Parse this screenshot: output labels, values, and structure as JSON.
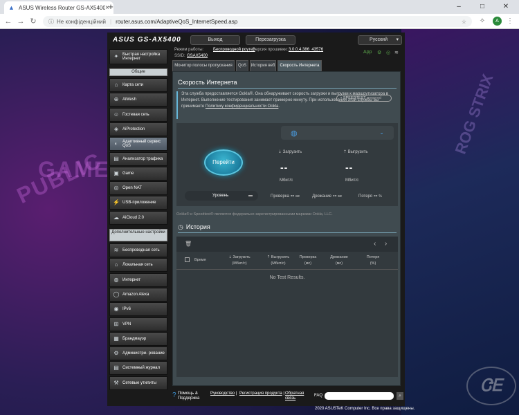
{
  "browser": {
    "tab_title": "ASUS Wireless Router GS-AX5400",
    "tab_close": "×",
    "new_tab": "+",
    "win_min": "–",
    "win_max": "□",
    "win_close": "✕",
    "security_label": "Не конфіденційний",
    "url": "router.asus.com/AdaptiveQoS_InternetSpeed.asp",
    "avatar_letter": "A"
  },
  "background": {
    "text_left_1": "PUBLIC OF GAMERS",
    "text_left_2": "GAMERS",
    "text_right": "ROG STRIX"
  },
  "router": {
    "logo": "ASUS",
    "model": "GS-AX5400",
    "logout": "Выход",
    "reboot": "Перезагрузка",
    "language": "Русский",
    "mode_label": "Режим работы:",
    "mode_value": "Беспроводной роутер",
    "fw_label": "Версия прошивки:",
    "fw_value": "3.0.0.4.386_43576",
    "ssid_label": "SSID:",
    "ssid_value": "GSAX5400",
    "app_label": "App"
  },
  "sidebar": {
    "quick": "Быстрая настройка Интернет",
    "general": "Общие",
    "items": [
      {
        "label": "Карта сети",
        "icon": "⌂"
      },
      {
        "label": "AiMesh",
        "icon": "⊕"
      },
      {
        "label": "Гостевая сеть",
        "icon": "☺"
      },
      {
        "label": "AiProtection",
        "icon": "◈"
      },
      {
        "label": "Адаптивный сервис QoS",
        "icon": "◐"
      },
      {
        "label": "Анализатор трафика",
        "icon": "▤"
      },
      {
        "label": "Game",
        "icon": "▣"
      },
      {
        "label": "Open NAT",
        "icon": "◎"
      },
      {
        "label": "USB-приложение",
        "icon": "⚡"
      },
      {
        "label": "AiCloud 2.0",
        "icon": "☁"
      }
    ],
    "advanced": "Дополнительные настройки",
    "adv_items": [
      {
        "label": "Беспроводная сеть",
        "icon": "≋"
      },
      {
        "label": "Локальная сеть",
        "icon": "⌂"
      },
      {
        "label": "Интернет",
        "icon": "◍"
      },
      {
        "label": "Amazon Alexa",
        "icon": "◯"
      },
      {
        "label": "IPv6",
        "icon": "◉"
      },
      {
        "label": "VPN",
        "icon": "⊞"
      },
      {
        "label": "Брандмауэр",
        "icon": "▦"
      },
      {
        "label": "Администри- рование",
        "icon": "⚙"
      },
      {
        "label": "Системный журнал",
        "icon": "▤"
      },
      {
        "label": "Сетевые утилиты",
        "icon": "⚒"
      }
    ]
  },
  "tabs": [
    "Монитор полосы пропускания",
    "QoS",
    "История веб",
    "Скорость Интернета"
  ],
  "speed": {
    "title": "Скорость Интернета",
    "desc": "Эта служба предоставляется Ookla®. Она обнаруживает скорость загрузки и выгрузки к маршрутизатора в Интернет. Выполнение тестирования занимает примерно минуту. При использовании этой службы вы принимаете",
    "desc_link": "Политику конфиденциальности Ookla",
    "desc_end": ".",
    "speedtest_logo": "SPEEDTEST",
    "speedtest_powered": "powered",
    "go": "Перейти",
    "download_label": "Загрузить",
    "upload_label": "Выгрузить",
    "download_value": "--",
    "upload_value": "--",
    "unit": "Мбит/с",
    "level": "Уровень",
    "ping_label": "Проверка",
    "jitter_label": "Дрожание",
    "loss_label": "Потеря",
    "ping_value": "--",
    "jitter_value": "--",
    "loss_value": "--",
    "ms": "мс",
    "pct": "%",
    "disclaimer": "Ookla® и Speedtest® являются федерально зарегистрированными марками Ookla, LLC."
  },
  "history": {
    "title": "История",
    "columns": [
      {
        "top": "Время",
        "bottom": ""
      },
      {
        "top": "Загрузить",
        "bottom": "(Мбит/с)"
      },
      {
        "top": "Выгрузить",
        "bottom": "(Мбит/с)"
      },
      {
        "top": "Проверка",
        "bottom": "(мс)"
      },
      {
        "top": "Дрожание",
        "bottom": "(мс)"
      },
      {
        "top": "Потеря",
        "bottom": "(%)"
      }
    ],
    "empty": "No Test Results."
  },
  "footer": {
    "help": "Помощь & Поддержка",
    "manual": "Руководство",
    "register": "Регистрация продукта",
    "feedback": "Обратная связь",
    "faq": "FAQ",
    "copyright": "2020 ASUSTeK Computer Inc. Все права защищены."
  }
}
